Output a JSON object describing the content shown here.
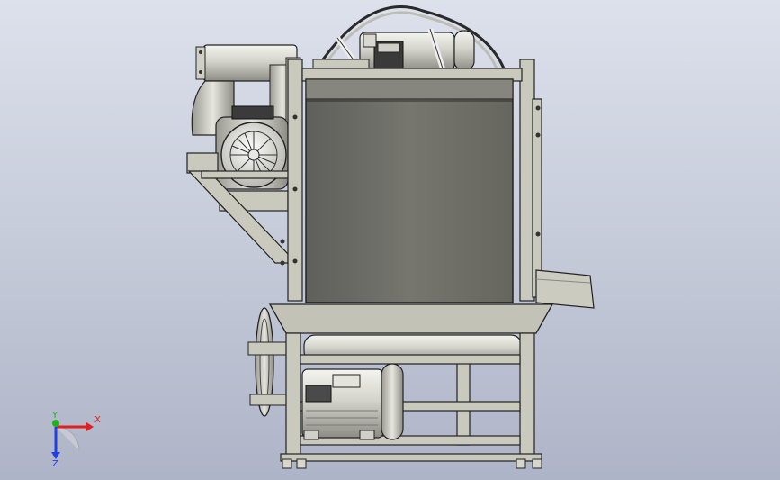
{
  "viewport": {
    "background_top": "#dde1ec",
    "background_bottom": "#aeb4c7"
  },
  "triad": {
    "x_label": "X",
    "y_label": "Y",
    "z_label": "Z",
    "x_color": "#e02020",
    "y_color": "#20b020",
    "z_color": "#2040e0"
  },
  "model": {
    "frame_color": "#c9c9bd",
    "panel_color": "#6f6f6a",
    "motor_color": "#dcdcd6",
    "outline_color": "#1e1e1e"
  }
}
